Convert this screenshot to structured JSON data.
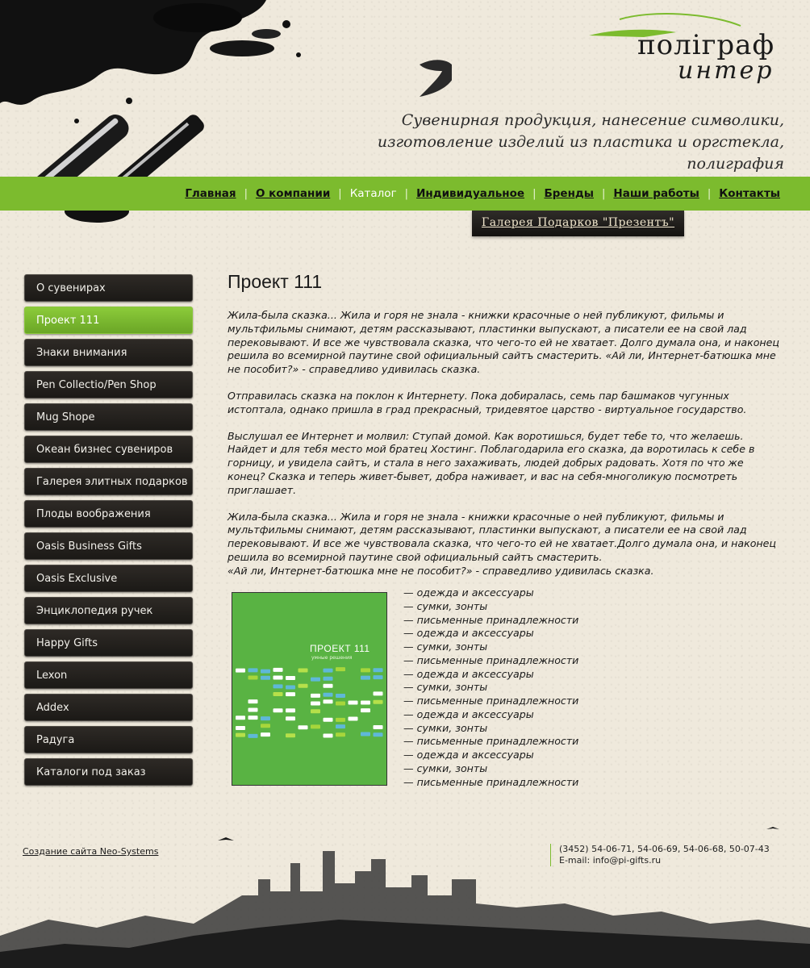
{
  "brand": {
    "logo_top": "полiграф",
    "logo_bottom": "интер",
    "tagline_line1": "Сувенирная продукция, нанесение символики,",
    "tagline_line2": "изготовление изделий из пластика и оргстекла, полиграфия"
  },
  "nav": {
    "items": [
      {
        "label": "Главная",
        "current": false
      },
      {
        "label": "О компании",
        "current": false
      },
      {
        "label": "Каталог",
        "current": true
      },
      {
        "label": "Индивидуальное",
        "current": false
      },
      {
        "label": "Бренды",
        "current": false
      },
      {
        "label": "Наши работы",
        "current": false
      },
      {
        "label": "Контакты",
        "current": false
      }
    ],
    "gallery_button": "Галерея Подарков \"Презентъ\""
  },
  "sidebar": {
    "items": [
      {
        "label": "О сувенирах",
        "active": false
      },
      {
        "label": "Проект 111",
        "active": true
      },
      {
        "label": "Знаки внимания",
        "active": false
      },
      {
        "label": "Pen Collectio/Pen Shop",
        "active": false
      },
      {
        "label": "Mug Shope",
        "active": false
      },
      {
        "label": "Океан бизнес сувениров",
        "active": false
      },
      {
        "label": "Галерея элитных подарков",
        "active": false
      },
      {
        "label": "Плоды воображения",
        "active": false
      },
      {
        "label": "Oasis Business Gifts",
        "active": false
      },
      {
        "label": "Oasis Exclusive",
        "active": false
      },
      {
        "label": "Энциклопедия ручек",
        "active": false
      },
      {
        "label": "Happy Gifts",
        "active": false
      },
      {
        "label": "Lexon",
        "active": false
      },
      {
        "label": "Addex",
        "active": false
      },
      {
        "label": "Радуга",
        "active": false
      },
      {
        "label": "Каталоги под заказ",
        "active": false
      }
    ]
  },
  "main": {
    "title": "Проект 111",
    "paragraphs": [
      "Жила-была сказка... Жила и горя не знала - книжки красочные о ней публикуют, фильмы и мультфильмы снимают, детям рассказывают, пластинки выпускают, а писатели ее на свой лад перековывают. И все же чувствовала сказка, что чего-то ей не хватает. Долго думала она, и наконец решила во всемирной паутине свой официальный сайтъ смастерить. «Ай ли, Интернет-батюшка мне не пособит?» - справедливо удивилась сказка.",
      "Отправилась сказка на поклон к Интернету. Пока добиралась, семь пар башмаков чугунных истоптала, однако пришла в град прекрасный, тридевятое царство - виртуальное государство.",
      "Выслушал ее Интернет и молвил: Ступай домой. Как воротишься, будет тебе то, что желаешь. Найдет и для тебя место мой братец Хостинг. Поблагодарила его сказка, да воротилась к себе в горницу, и увидела сайтъ, и стала в него захаживать, людей добрых радовать. Хотя по что же конец? Сказка и теперь живет-бывет, добра наживает, и вас на себя-многоликую посмотреть приглашает.",
      "Жила-была сказка... Жила и горя не знала - книжки красочные о ней публикуют, фильмы и мультфильмы снимают, детям рассказывают, пластинки выпускают, а писатели ее на свой лад перековывают. И все же чувствовала сказка, что чего-то ей не хватает.Долго думала она, и наконец решила во всемирной паутине свой официальный сайтъ смастерить.\n«Ай ли, Интернет-батюшка мне не пособит?» - справедливо удивилась сказка."
    ],
    "catalog_cover": {
      "title": "ПРОЕКТ 111",
      "subtitle": "умные решения"
    },
    "list": [
      "— одежда и аксессуары",
      "— сумки, зонты",
      "— письменные принадлежности",
      "— одежда и аксессуары",
      "— сумки, зонты",
      "— письменные принадлежности",
      "— одежда и аксессуары",
      "— сумки, зонты",
      "— письменные принадлежности",
      "— одежда и аксессуары",
      "— сумки, зонты",
      "— письменные принадлежности",
      "— одежда и аксессуары",
      "— сумки, зонты",
      "— письменные принадлежности"
    ]
  },
  "footer": {
    "credit_link": "Создание сайта Neo-Systems",
    "phones": "(3452) 54-06-71, 54-06-69, 54-06-68, 50-07-43",
    "email": "E-mail: info@pi-gifts.ru"
  },
  "colors": {
    "accent_green": "#7cbb2e",
    "dark_button": "#1f1c19",
    "page_bg": "#efe9dc"
  }
}
